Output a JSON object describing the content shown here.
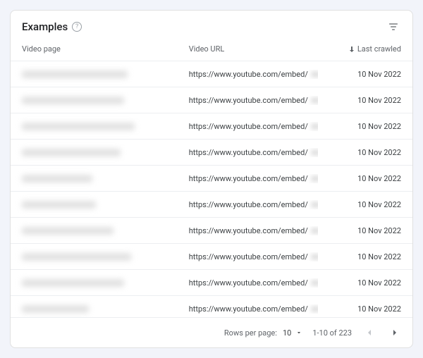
{
  "header": {
    "title": "Examples",
    "help_glyph": "?"
  },
  "columns": {
    "page": "Video page",
    "url": "Video URL",
    "date": "Last crawled"
  },
  "rows": [
    {
      "page_redacted_widthpx": 150,
      "url": "https://www.youtube.com/embed/",
      "date": "10 Nov 2022"
    },
    {
      "page_redacted_widthpx": 145,
      "url": "https://www.youtube.com/embed/",
      "date": "10 Nov 2022"
    },
    {
      "page_redacted_widthpx": 160,
      "url": "https://www.youtube.com/embed/",
      "date": "10 Nov 2022"
    },
    {
      "page_redacted_widthpx": 140,
      "url": "https://www.youtube.com/embed/",
      "date": "10 Nov 2022"
    },
    {
      "page_redacted_widthpx": 100,
      "url": "https://www.youtube.com/embed/",
      "date": "10 Nov 2022"
    },
    {
      "page_redacted_widthpx": 105,
      "url": "https://www.youtube.com/embed/",
      "date": "10 Nov 2022"
    },
    {
      "page_redacted_widthpx": 130,
      "url": "https://www.youtube.com/embed/",
      "date": "10 Nov 2022"
    },
    {
      "page_redacted_widthpx": 155,
      "url": "https://www.youtube.com/embed/",
      "date": "10 Nov 2022"
    },
    {
      "page_redacted_widthpx": 145,
      "url": "https://www.youtube.com/embed/",
      "date": "10 Nov 2022"
    },
    {
      "page_redacted_widthpx": 95,
      "url": "https://www.youtube.com/embed/",
      "date": "10 Nov 2022"
    }
  ],
  "footer": {
    "rows_per_page_label": "Rows per page:",
    "rows_per_page_value": "10",
    "range_text": "1-10 of 223"
  }
}
